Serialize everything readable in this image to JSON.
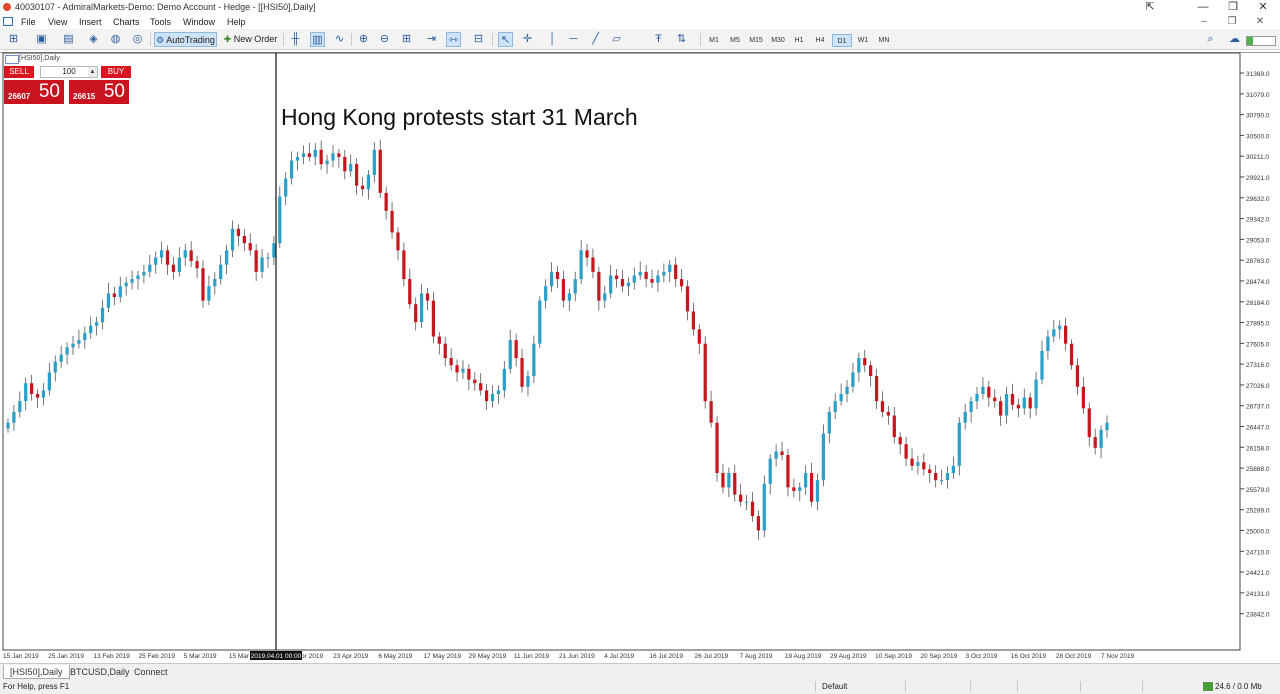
{
  "window": {
    "title": "40030107 - AdmiralMarkets-Demo: Demo Account - Hedge - [[HSI50],Daily]",
    "controls": [
      "—",
      "❐",
      "✕"
    ]
  },
  "menu": {
    "items": [
      "File",
      "View",
      "Insert",
      "Charts",
      "Tools",
      "Window",
      "Help"
    ]
  },
  "toolbar": {
    "autotrading_label": "AutoTrading",
    "new_order_label": "New Order",
    "timeframes": [
      "M1",
      "M5",
      "M15",
      "M30",
      "H1",
      "H4",
      "D1",
      "W1",
      "MN"
    ],
    "active_timeframe": "D1"
  },
  "chart": {
    "title": "[HSI50],Daily",
    "annotation": "Hong Kong protests start 31 March",
    "vline_label": "2019.04.01 00:00",
    "up_color": "#2aa0c8",
    "down_color": "#c8161f"
  },
  "one_click": {
    "sell_label": "SELL",
    "buy_label": "BUY",
    "quantity": "100",
    "sell_small": "26607",
    "sell_big": "50",
    "buy_small": "26615",
    "buy_big": "50"
  },
  "chart_data": {
    "type": "candlestick",
    "ylim": [
      23642.0,
      31369.0
    ],
    "price_labels": [
      "31369.0",
      "31079.0",
      "30790.0",
      "30500.0",
      "30211.0",
      "29921.0",
      "29632.0",
      "29342.0",
      "29053.0",
      "28763.0",
      "28474.0",
      "28184.0",
      "27895.0",
      "27605.0",
      "27316.0",
      "27026.0",
      "26737.0",
      "26447.0",
      "26158.0",
      "25868.0",
      "25579.0",
      "25289.0",
      "25000.0",
      "24710.0",
      "24421.0",
      "24131.0",
      "23842.0"
    ],
    "date_labels": [
      "15 Jan 2019",
      "25 Jan 2019",
      "13 Feb 2019",
      "25 Feb 2019",
      "5 Mar 2019",
      "15 Mar 2019",
      "10 Apr 2019",
      "23 Apr 2019",
      "6 May 2019",
      "17 May 2019",
      "29 May 2019",
      "11 Jun 2019",
      "21 Jun 2019",
      "4 Jul 2019",
      "16 Jul 2019",
      "26 Jul 2019",
      "7 Aug 2019",
      "19 Aug 2019",
      "29 Aug 2019",
      "10 Sep 2019",
      "20 Sep 2019",
      "3 Oct 2019",
      "16 Oct 2019",
      "28 Oct 2019",
      "7 Nov 2019"
    ],
    "closes": [
      26500,
      26650,
      26800,
      27050,
      26900,
      26850,
      26950,
      27200,
      27350,
      27450,
      27550,
      27600,
      27650,
      27750,
      27850,
      27900,
      28100,
      28300,
      28250,
      28400,
      28450,
      28500,
      28550,
      28600,
      28700,
      28800,
      28900,
      28700,
      28600,
      28800,
      28900,
      28750,
      28650,
      28200,
      28400,
      28500,
      28700,
      28900,
      29200,
      29100,
      29000,
      28900,
      28600,
      28800,
      28800,
      29000,
      29650,
      29900,
      30150,
      30200,
      30250,
      30200,
      30300,
      30100,
      30150,
      30250,
      30200,
      30000,
      30100,
      29800,
      29750,
      29950,
      30300,
      29700,
      29450,
      29150,
      28900,
      28500,
      28150,
      27900,
      28300,
      28200,
      27700,
      27600,
      27400,
      27300,
      27200,
      27250,
      27100,
      27050,
      26950,
      26800,
      26900,
      26950,
      27250,
      27650,
      27400,
      27000,
      27150,
      27600,
      28200,
      28400,
      28600,
      28500,
      28200,
      28300,
      28500,
      28900,
      28800,
      28600,
      28200,
      28300,
      28550,
      28500,
      28400,
      28450,
      28550,
      28600,
      28500,
      28450,
      28550,
      28600,
      28700,
      28500,
      28400,
      28050,
      27800,
      27600,
      26800,
      26500,
      25800,
      25600,
      25800,
      25500,
      25400,
      25400,
      25200,
      25000,
      25650,
      26000,
      26100,
      26050,
      25600,
      25550,
      25600,
      25800,
      25400,
      25700,
      26350,
      26650,
      26800,
      26900,
      27000,
      27200,
      27400,
      27300,
      27150,
      26800,
      26650,
      26600,
      26300,
      26200,
      26000,
      25900,
      25950,
      25850,
      25800,
      25700,
      25700,
      25800,
      25900,
      26500,
      26650,
      26800,
      26900,
      27000,
      26850,
      26800,
      26600,
      26900,
      26750,
      26700,
      26850,
      26700,
      27100,
      27500,
      27700,
      27800,
      27850,
      27600,
      27300,
      27000,
      26700,
      26300,
      26150,
      26400,
      26500
    ],
    "vline_date": "2019.04.01 00:00"
  }
}
